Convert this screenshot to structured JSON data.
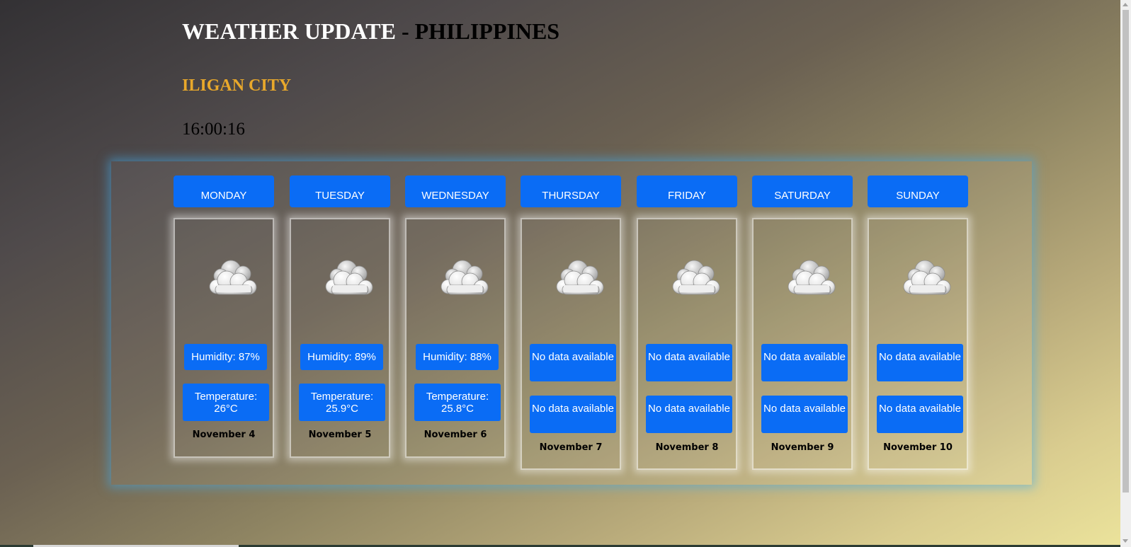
{
  "header": {
    "title_main": "WEATHER UPDATE",
    "title_sep": " - ",
    "title_country": "PHILIPPINES",
    "city": "ILIGAN CITY",
    "time": "16:00:16"
  },
  "colors": {
    "accent_blue": "#0a6cf5",
    "city_gold": "#e8a82b",
    "panel_glow": "#46aae6"
  },
  "icon": "cloudy-icon",
  "days": [
    {
      "day": "MONDAY",
      "humidity": "Humidity: 87%",
      "temperature": "Temperature: 26°C",
      "date": "November 4"
    },
    {
      "day": "TUESDAY",
      "humidity": "Humidity: 89%",
      "temperature": "Temperature: 25.9°C",
      "date": "November 5"
    },
    {
      "day": "WEDNESDAY",
      "humidity": "Humidity: 88%",
      "temperature": "Temperature: 25.8°C",
      "date": "November 6"
    },
    {
      "day": "THURSDAY",
      "humidity": "No data available",
      "temperature": "No data available",
      "date": "November 7"
    },
    {
      "day": "FRIDAY",
      "humidity": "No data available",
      "temperature": "No data available",
      "date": "November 8"
    },
    {
      "day": "SATURDAY",
      "humidity": "No data available",
      "temperature": "No data available",
      "date": "November 9"
    },
    {
      "day": "SUNDAY",
      "humidity": "No data available",
      "temperature": "No data available",
      "date": "November 10"
    }
  ]
}
